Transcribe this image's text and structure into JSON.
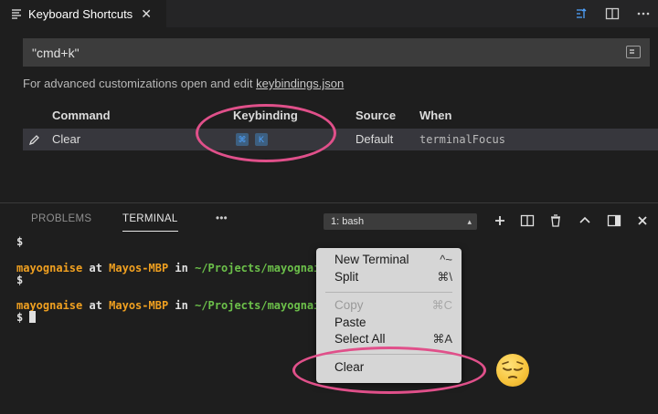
{
  "editor_tab": {
    "title": "Keyboard Shortcuts",
    "close": "✕",
    "icon": "list-icon"
  },
  "editor_actions": [
    "open-keybindings-json-icon",
    "split-editor-icon",
    "more-actions-icon"
  ],
  "search": {
    "value": "\"cmd+k\"",
    "record_icon": "record-keys-icon"
  },
  "hint": {
    "prefix": "For advanced customizations open and edit ",
    "link": "keybindings.json"
  },
  "table": {
    "headers": {
      "command": "Command",
      "keybinding": "Keybinding",
      "source": "Source",
      "when": "When"
    },
    "rows": [
      {
        "command": "Clear",
        "keys": [
          "⌘",
          "K"
        ],
        "source": "Default",
        "when": "terminalFocus"
      }
    ]
  },
  "panel": {
    "tabs": [
      "PROBLEMS",
      "TERMINAL",
      "•••"
    ],
    "active_tab": "TERMINAL",
    "terminal_select": "1: bash",
    "actions": [
      "add-terminal-icon",
      "split-terminal-icon",
      "trash-icon",
      "maximize-chevron-icon",
      "toggle-panel-icon",
      "close-icon"
    ]
  },
  "terminal": {
    "prompt": "$",
    "lines": [
      {
        "user": "mayognaise",
        "at": " at ",
        "host": "Mayos-MBP",
        "in": " in ",
        "path": "~/Projects/mayognaise"
      },
      {
        "user": "mayognaise",
        "at": " at ",
        "host": "Mayos-MBP",
        "in": " in ",
        "path": "~/Projects/mayognaise"
      }
    ]
  },
  "context_menu": {
    "items": [
      {
        "label": "New Terminal",
        "shortcut": "^~",
        "enabled": true
      },
      {
        "label": "Split",
        "shortcut": "⌘\\",
        "enabled": true
      },
      {
        "label": "Copy",
        "shortcut": "⌘C",
        "enabled": false
      },
      {
        "label": "Paste",
        "shortcut": "",
        "enabled": true
      },
      {
        "label": "Select All",
        "shortcut": "⌘A",
        "enabled": true
      },
      {
        "label": "Clear",
        "shortcut": "",
        "enabled": true
      }
    ]
  },
  "colors": {
    "annotation": "#e0508a",
    "accent_key": "#4fa3ff"
  }
}
